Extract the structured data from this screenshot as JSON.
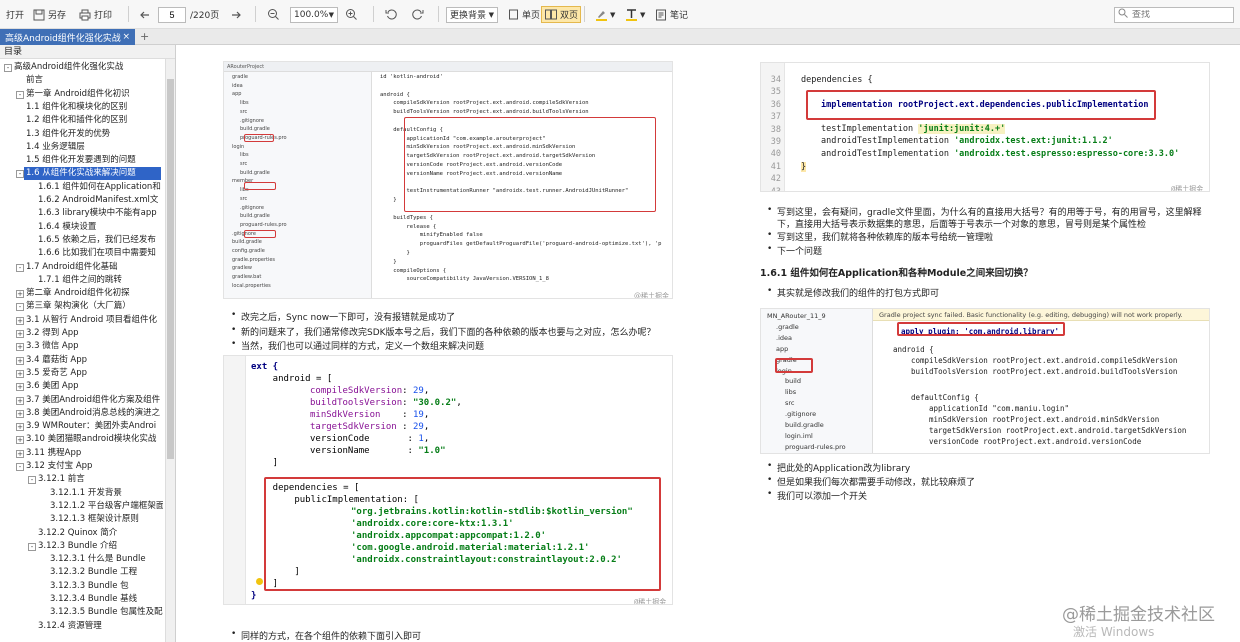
{
  "toolbar": {
    "open": "打开",
    "save_as": "另存",
    "print": "打印",
    "page_current": "5",
    "page_total": "/220页",
    "zoom": "100.0%",
    "background": "更换背景",
    "single_page": "单页",
    "double_page": "双页",
    "note": "笔记",
    "search_placeholder": "查找"
  },
  "tabs": [
    {
      "label": "高级Android组件化强化实战"
    }
  ],
  "sidebar": {
    "header": "目录",
    "items": [
      {
        "label": "高级Android组件化强化实战",
        "level": 0,
        "toggle": "-"
      },
      {
        "label": "前言",
        "level": 1,
        "toggle": ""
      },
      {
        "label": "第一章 Android组件化初识",
        "level": 1,
        "toggle": "-"
      },
      {
        "label": "1.1 组件化和模块化的区别",
        "level": 2,
        "toggle": ""
      },
      {
        "label": "1.2 组件化和插件化的区别",
        "level": 2,
        "toggle": ""
      },
      {
        "label": "1.3 组件化开发的优势",
        "level": 2,
        "toggle": ""
      },
      {
        "label": "1.4 业务逻辑层",
        "level": 2,
        "toggle": ""
      },
      {
        "label": "1.5 组件化开发要遇到的问题",
        "level": 2,
        "toggle": ""
      },
      {
        "label": "1.6 从组件化实战来解决问题",
        "level": 2,
        "toggle": "-",
        "selected": true
      },
      {
        "label": "1.6.1 组件如何在Application和",
        "level": 3,
        "toggle": ""
      },
      {
        "label": "1.6.2 AndroidManifest.xml文",
        "level": 3,
        "toggle": ""
      },
      {
        "label": "1.6.3 library模块中不能有app",
        "level": 3,
        "toggle": ""
      },
      {
        "label": "1.6.4 模块设置",
        "level": 3,
        "toggle": ""
      },
      {
        "label": "1.6.5 依赖之后，我们已经发布",
        "level": 3,
        "toggle": ""
      },
      {
        "label": "1.6.6 比如我们在项目中需要知",
        "level": 3,
        "toggle": ""
      },
      {
        "label": "1.7 Android组件化基础",
        "level": 2,
        "toggle": "-"
      },
      {
        "label": "1.7.1 组件之间的跳转",
        "level": 3,
        "toggle": ""
      },
      {
        "label": "第二章 Android组件化初探",
        "level": 1,
        "toggle": "+"
      },
      {
        "label": "第三章 架构演化（大厂篇）",
        "level": 1,
        "toggle": "-"
      },
      {
        "label": "3.1 从智行 Android 项目看组件化",
        "level": 2,
        "toggle": "+"
      },
      {
        "label": "3.2 得到 App",
        "level": 2,
        "toggle": "+"
      },
      {
        "label": "3.3 微信 App",
        "level": 2,
        "toggle": "+"
      },
      {
        "label": "3.4 蘑菇街 App",
        "level": 2,
        "toggle": "+"
      },
      {
        "label": "3.5 爱奇艺 App",
        "level": 2,
        "toggle": "+"
      },
      {
        "label": "3.6 美团 App",
        "level": 2,
        "toggle": "+"
      },
      {
        "label": "3.7 美团Android组件化方案及组件",
        "level": 2,
        "toggle": "+"
      },
      {
        "label": "3.8 美团Android消息总线的演进之",
        "level": 2,
        "toggle": "+"
      },
      {
        "label": "3.9 WMRouter：美团外卖Androi",
        "level": 2,
        "toggle": "+"
      },
      {
        "label": "3.10 美团猫眼android模块化实战",
        "level": 2,
        "toggle": "+"
      },
      {
        "label": "3.11 携程App",
        "level": 2,
        "toggle": "+"
      },
      {
        "label": "3.12 支付宝 App",
        "level": 2,
        "toggle": "-"
      },
      {
        "label": "3.12.1 前言",
        "level": 3,
        "toggle": "-"
      },
      {
        "label": "3.12.1.1 开发背景",
        "level": 4,
        "toggle": ""
      },
      {
        "label": "3.12.1.2 平台级客户端框架面临",
        "level": 4,
        "toggle": ""
      },
      {
        "label": "3.12.1.3 框架设计原则",
        "level": 4,
        "toggle": ""
      },
      {
        "label": "3.12.2 Quinox 简介",
        "level": 3,
        "toggle": ""
      },
      {
        "label": "3.12.3 Bundle 介绍",
        "level": 3,
        "toggle": "-"
      },
      {
        "label": "3.12.3.1 什么是 Bundle",
        "level": 4,
        "toggle": ""
      },
      {
        "label": "3.12.3.2 Bundle 工程",
        "level": 4,
        "toggle": ""
      },
      {
        "label": "3.12.3.3 Bundle 包",
        "level": 4,
        "toggle": ""
      },
      {
        "label": "3.12.3.4 Bundle 基线",
        "level": 4,
        "toggle": ""
      },
      {
        "label": "3.12.3.5 Bundle 包属性及配置",
        "level": 4,
        "toggle": ""
      },
      {
        "label": "3.12.4 资源管理",
        "level": 3,
        "toggle": ""
      }
    ]
  },
  "left_page": {
    "bullets": [
      "改完之后，Sync now一下即可，没有报错就是成功了",
      "新的问题来了，我们通常修改完SDK版本号之后，我们下面的各种依赖的版本也要与之对应，怎么办呢？",
      "当然，我们也可以通过同样的方式，定义一个数组来解决问题"
    ],
    "bottom_bullet": "同样的方式，在各个组件的依赖下面引入即可",
    "caption": "@稀土掘金技术社区",
    "code": {
      "line1": "ext {",
      "line2": "    android = [",
      "line3_key": "compileSdkVersion",
      "line3_val": "29",
      "line4_key": "buildToolsVersion",
      "line4_val": "\"30.0.2\"",
      "line5_key": "minSdkVersion",
      "line5_val": "19",
      "line6_key": "targetSdkVersion",
      "line6_val": "29",
      "line7_key": "versionCode",
      "line7_val": "1",
      "line8_key": "versionName",
      "line8_val": "\"1.0\"",
      "line9": "    ]",
      "dep_open": "    dependencies = [",
      "dep_impl": "        publicImplementation: [",
      "dep_1": "\"org.jetbrains.kotlin:kotlin-stdlib:$kotlin_version\"",
      "dep_2": "'androidx.core:core-ktx:1.3.1'",
      "dep_3": "'androidx.appcompat:appcompat:1.2.0'",
      "dep_4": "'com.google.android.material:material:1.2.1'",
      "dep_5": "'androidx.constraintlayout:constraintlayout:2.0.2'",
      "dep_close1": "        ]",
      "dep_close2": "    ]",
      "close": "}"
    }
  },
  "right_page": {
    "code_top": {
      "line_numbers": [
        "34",
        "35",
        "36",
        "37",
        "38",
        "39",
        "40",
        "41",
        "42",
        "43"
      ],
      "l1": "dependencies {",
      "l2": "implementation rootProject.ext.dependencies.publicImplementation",
      "l3": "testImplementation ",
      "l3_str": "'junit:junit:4.+'",
      "l4": "androidTestImplementation ",
      "l4_str": "'androidx.test.ext:junit:1.1.2'",
      "l5": "androidTestImplementation ",
      "l5_str": "'androidx.test.espresso:espresso-core:3.3.0'",
      "l6": "}"
    },
    "bullets": [
      "写到这里，会有疑问，gradle文件里面，为什么有的直接用大括号？有的用等于号，有的用冒号，这里解释",
      "下，直接用大括号表示数据集的意思，后面等于号表示一个对象的意思，冒号则是某个属性检",
      "写到这里，我们就将各种依赖库的版本号给统一管理啦",
      "下一个问题"
    ],
    "heading": "1.6.1 组件如何在Application和各种Module之间来回切换？",
    "bullet_after_heading": "其实就是修改我们的组件的打包方式即可",
    "tree": [
      "MN_ARouter_11_9",
      ".gradle",
      ".idea",
      "app",
      "gradle",
      "login",
      "build",
      "libs",
      "src",
      ".gitignore",
      "build.gradle",
      "login.iml",
      "proguard-rules.pro"
    ],
    "sync_warning": "Gradle project sync failed. Basic functionality (e.g. editing, debugging) will not work properly.",
    "gradle_code": {
      "apply": "apply plugin: 'com.android.library'",
      "android": "android {",
      "c1": "compileSdkVersion rootProject.ext.android.compileSdkVersion",
      "c2": "buildToolsVersion rootProject.ext.android.buildToolsVersion",
      "default": "defaultConfig {",
      "appid": "applicationId \"com.maniu.login\"",
      "c3": "minSdkVersion rootProject.ext.android.minSdkVersion",
      "c4": "targetSdkVersion rootProject.ext.android.targetSdkVersion",
      "c5": "versionCode rootProject.ext.android.versionCode"
    },
    "bottom_bullets": [
      "把此处的Application改为library",
      "但是如果我们每次都需要手动修改，就比较麻烦了",
      "我们可以添加一个开关"
    ],
    "caption": "@稀土掘金技术社区"
  },
  "ide_screenshot": {
    "project_title": "ARouterProject",
    "files": [
      "gradle",
      "idea",
      "app",
      "libs",
      "src",
      ".gitignore",
      "build.gradle",
      "proguard-rules.pro",
      "login",
      "libs",
      "src",
      "build.gradle",
      "member",
      "libs",
      "src",
      ".gitignore",
      "build.gradle",
      "proguard-rules.pro",
      ".gitignore",
      "build.gradle",
      "config.gradle",
      "gradle.properties",
      "gradlew",
      "gradlew.bat",
      "local.properties"
    ],
    "code_lines": [
      "id 'kotlin-android'",
      "",
      "android {",
      "    compileSdkVersion rootProject.ext.android.compileSdkVersion",
      "    buildToolsVersion rootProject.ext.android.buildToolsVersion",
      "",
      "    defaultConfig {",
      "        applicationId \"com.example.arouterproject\"",
      "        minSdkVersion rootProject.ext.android.minSdkVersion",
      "        targetSdkVersion rootProject.ext.android.targetSdkVersion",
      "        versionCode rootProject.ext.android.versionCode",
      "        versionName rootProject.ext.android.versionName",
      "",
      "        testInstrumentationRunner \"androidx.test.runner.AndroidJUnitRunner\"",
      "    }",
      "",
      "    buildTypes {",
      "        release {",
      "            minifyEnabled false",
      "            proguardFiles getDefaultProguardFile('proguard-android-optimize.txt'), 'p",
      "        }",
      "    }",
      "    compileOptions {",
      "        sourceCompatibility JavaVersion.VERSION_1_8"
    ]
  },
  "watermark": "@稀土掘金技术社区",
  "os_overlay": "激活 Windows"
}
